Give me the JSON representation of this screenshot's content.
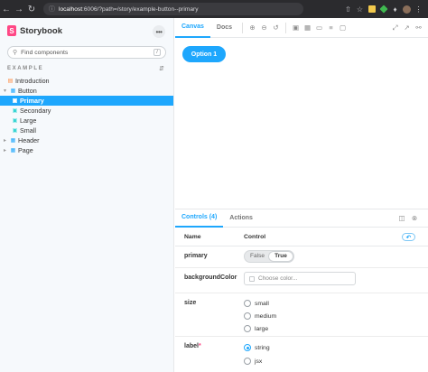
{
  "browser": {
    "url_host": "localhost",
    "url_rest": ":6006/?path=/story/example-button--primary"
  },
  "sidebar": {
    "brand": "Storybook",
    "brand_logo_letter": "S",
    "menu_glyph": "•••",
    "search_placeholder": "Find components",
    "search_shortcut": "/",
    "group_label": "EXAMPLE",
    "items": [
      {
        "label": "Introduction",
        "kind": "doc"
      },
      {
        "label": "Button",
        "kind": "component"
      },
      {
        "label": "Primary",
        "kind": "story",
        "selected": true
      },
      {
        "label": "Secondary",
        "kind": "story"
      },
      {
        "label": "Large",
        "kind": "story"
      },
      {
        "label": "Small",
        "kind": "story"
      },
      {
        "label": "Header",
        "kind": "component"
      },
      {
        "label": "Page",
        "kind": "component"
      }
    ]
  },
  "toolbar": {
    "tabs": [
      "Canvas",
      "Docs"
    ],
    "active_tab": "Canvas"
  },
  "preview": {
    "button_label": "Option 1",
    "button_color": "#1ea7fd"
  },
  "panel": {
    "tabs": [
      "Controls (4)",
      "Actions"
    ],
    "active_tab": "Controls (4)",
    "columns": {
      "name": "Name",
      "control": "Control"
    },
    "rows": {
      "primary": {
        "name": "primary",
        "options": [
          "False",
          "True"
        ],
        "selected": "True"
      },
      "backgroundColor": {
        "name": "backgroundColor",
        "placeholder": "Choose color..."
      },
      "size": {
        "name": "size",
        "options": [
          "small",
          "medium",
          "large"
        ],
        "selected": null
      },
      "label": {
        "name": "label",
        "required_mark": "*",
        "options": [
          "string",
          "jsx"
        ],
        "selected": "string"
      }
    }
  },
  "colors": {
    "accent": "#1ea7fd",
    "brand": "#ff4785"
  }
}
